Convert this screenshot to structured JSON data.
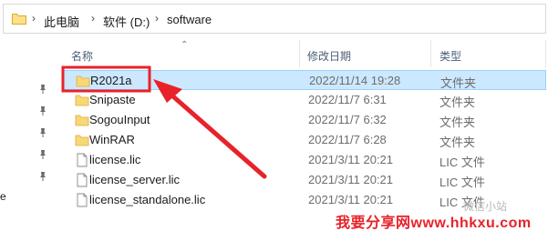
{
  "address": {
    "folder_icon": "folder-icon",
    "separator": "›",
    "crumbs": [
      "此电脑",
      "软件 (D:)",
      "software"
    ]
  },
  "columns": {
    "name": "名称",
    "modified": "修改日期",
    "type": "类型"
  },
  "files": [
    {
      "name": "R2021a",
      "date": "2022/11/14 19:28",
      "type": "文件夹",
      "icon": "folder-icon",
      "selected": true
    },
    {
      "name": "Snipaste",
      "date": "2022/11/7 6:31",
      "type": "文件夹",
      "icon": "folder-icon",
      "selected": false
    },
    {
      "name": "SogouInput",
      "date": "2022/11/7 6:32",
      "type": "文件夹",
      "icon": "folder-icon",
      "selected": false
    },
    {
      "name": "WinRAR",
      "date": "2022/11/7 6:28",
      "type": "文件夹",
      "icon": "folder-icon",
      "selected": false
    },
    {
      "name": "license.lic",
      "date": "2021/3/11 20:21",
      "type": "LIC 文件",
      "icon": "document-icon",
      "selected": false
    },
    {
      "name": "license_server.lic",
      "date": "2021/3/11 20:21",
      "type": "LIC 文件",
      "icon": "document-icon",
      "selected": false
    },
    {
      "name": "license_standalone.lic",
      "date": "2021/3/11 20:21",
      "type": "LIC 文件",
      "icon": "document-icon",
      "selected": false
    }
  ],
  "nav": {
    "fragment": "e"
  },
  "watermark": {
    "main": "我要分享网www.hhkxu.com",
    "faint": "微信小站"
  },
  "colors": {
    "selection_bg": "#cce8ff",
    "selection_border": "#99d1ff",
    "folder_yellow": "#f8d775",
    "arrow_red": "#e8222a",
    "header_text": "#4c607a"
  }
}
